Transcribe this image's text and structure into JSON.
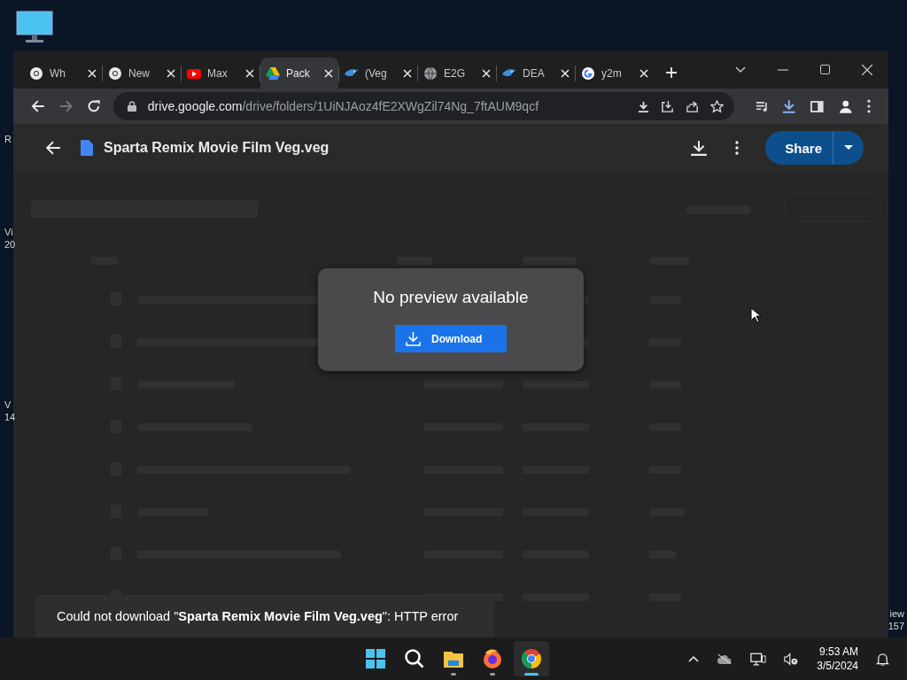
{
  "desktop": {
    "labels": [
      {
        "text": "R"
      },
      {
        "text": "Vi\n20"
      },
      {
        "text": "V\n14"
      },
      {
        "text": "iew\n157"
      }
    ]
  },
  "browser": {
    "tabs": [
      {
        "title": "Wh",
        "kind": "chrome",
        "selected": false
      },
      {
        "title": "New",
        "kind": "chrome",
        "selected": false
      },
      {
        "title": "Max",
        "kind": "youtube",
        "selected": false
      },
      {
        "title": "Pack",
        "kind": "drive",
        "selected": true
      },
      {
        "title": "(Veg",
        "kind": "bird",
        "selected": false
      },
      {
        "title": "E2G",
        "kind": "globe",
        "selected": false
      },
      {
        "title": "DEA",
        "kind": "bird",
        "selected": false
      },
      {
        "title": "y2m",
        "kind": "google",
        "selected": false
      }
    ],
    "url": {
      "host": "drive.google.com",
      "path": "/drive/folders/1UiNJAoz4fE2XWgZil74Ng_7ftAUM9qcf"
    }
  },
  "viewer": {
    "file_title": "Sparta Remix Movie Film Veg.veg",
    "share_label": "Share"
  },
  "dialog": {
    "message": "No preview available",
    "button": "Download"
  },
  "toast": {
    "text": "Could not download \"**Sparta Remix Movie Film Veg.veg**\": HTTP error"
  },
  "taskbar": {
    "apps": [
      {
        "kind": "start",
        "running": false,
        "selected": false
      },
      {
        "kind": "search",
        "running": false,
        "selected": false
      },
      {
        "kind": "explorer",
        "running": true,
        "selected": false
      },
      {
        "kind": "firefox",
        "running": true,
        "selected": false
      },
      {
        "kind": "chrome",
        "running": true,
        "selected": true
      }
    ],
    "time": "9:53 AM",
    "date": "3/5/2024"
  }
}
